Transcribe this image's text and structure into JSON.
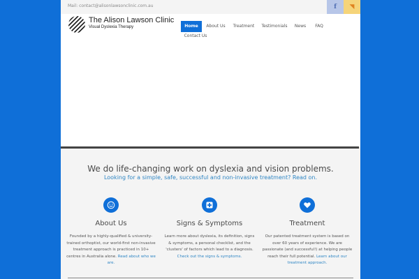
{
  "header": {
    "mail": "Mail: contact@alisonlawsonclinic.com.au",
    "social": {
      "facebook_glyph": "f",
      "rss_glyph": "◥"
    },
    "logo": {
      "title": "The Alison Lawson Clinic",
      "subtitle": "Visual Dyslexia Therapy"
    }
  },
  "nav": {
    "home": "Home",
    "about": "About Us",
    "treatment": "Treatment",
    "testimonials": "Testimonials",
    "news": "News",
    "faq": "FAQ",
    "contact": "Contact Us"
  },
  "intro": {
    "headline": "We do life-changing work on dyslexia and vision problems.",
    "subline": "Looking for a simple, safe, successful and non-invasive treatment? Read on."
  },
  "features": {
    "about": {
      "title": "About Us",
      "body": "Founded by a highly-qualified & university-trained orthoptist, our world-first non-invasive treatment approach is practiced in 10+ centres in Australia alone.",
      "link": "Read about who we are."
    },
    "signs": {
      "title": "Signs & Symptoms",
      "body": "Learn more about dyslexia, its definition, signs & symptoms, a personal checklist, and the 'clusters' of factors which lead to a diagnosis.",
      "link": "Check out the signs & symptoms."
    },
    "treatment": {
      "title": "Treatment",
      "body": "Our patented treatment system is based on over 60 years of experience. We are passionate (and successful!) at helping people reach their full potential.",
      "link": "Learn about our treatment approach."
    }
  },
  "colors": {
    "accent": "#0f6fd8",
    "link": "#2f86c4",
    "page_background": "#0f6fd8"
  },
  "icons": {
    "about": "smiley-icon",
    "signs": "medical-plus-icon",
    "treatment": "heart-icon"
  }
}
